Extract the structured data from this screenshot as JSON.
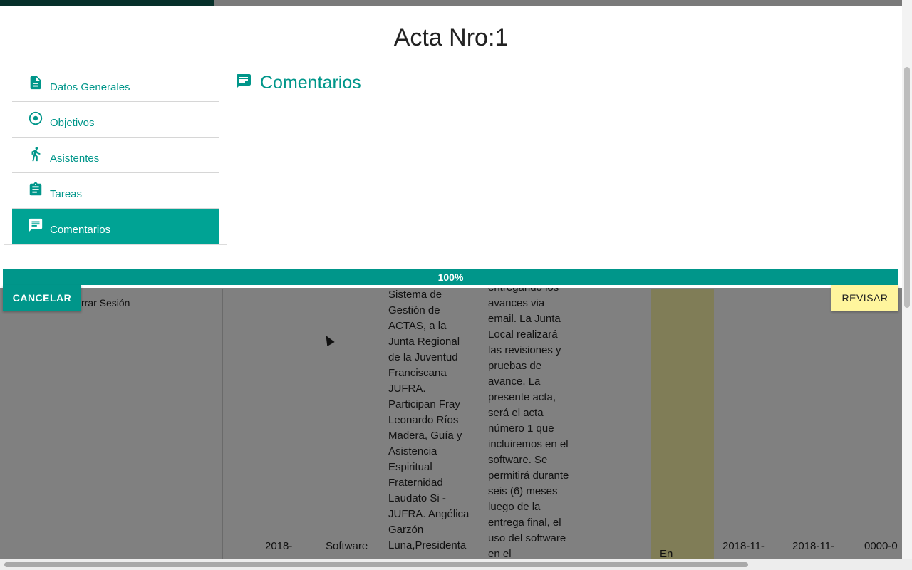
{
  "modal": {
    "title": "Acta Nro:1",
    "nav": [
      {
        "label": "Datos Generales",
        "icon": "document-icon"
      },
      {
        "label": "Objetivos",
        "icon": "target-icon"
      },
      {
        "label": "Asistentes",
        "icon": "walk-icon"
      },
      {
        "label": "Tareas",
        "icon": "clipboard-icon"
      },
      {
        "label": "Comentarios",
        "icon": "comment-icon",
        "active": true
      }
    ],
    "panel_title": "Comentarios",
    "progress": {
      "value": 100,
      "label": "100%"
    },
    "cancel_label": "CANCELAR",
    "review_label": "REVISAR"
  },
  "background": {
    "logout_label": "rrar Sesión",
    "description_col": "Sistema de Gestión de ACTAS, a la Junta Regional de la Juventud Franciscana JUFRA. Participan Fray Leonardo Ríos Madera, Guía y Asistencia Espiritual Fraternidad Laudato Si - JUFRA. Angélica Garzón Luna,Presidenta",
    "notes_col": "entregando los avances via email. La Junta Local realizará las revisiones y pruebas de avance. La presente acta, será el acta número 1 que incluiremos en el software. Se permitirá durante seis (6) meses luego de la entrega final, el uso del software en el",
    "row": {
      "date": "2018-",
      "title": "Software",
      "status": "En",
      "date2": "2018-11-",
      "date3": "2018-11-",
      "date4": "0000-0"
    }
  },
  "colors": {
    "accent": "#00968a",
    "active_nav": "#00a394",
    "review": "#fff59d"
  }
}
